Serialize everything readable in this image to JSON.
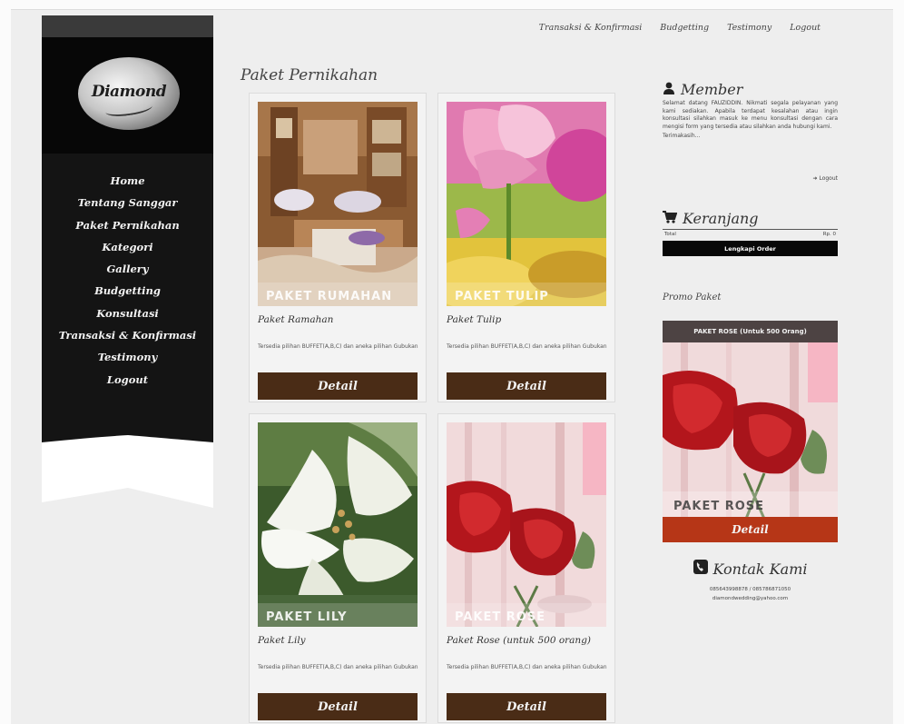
{
  "site": {
    "logo_text": "Diamond"
  },
  "sidebar": {
    "items": [
      {
        "label": "Home"
      },
      {
        "label": "Tentang Sanggar"
      },
      {
        "label": "Paket Pernikahan"
      },
      {
        "label": "Kategori"
      },
      {
        "label": "Gallery"
      },
      {
        "label": "Budgetting"
      },
      {
        "label": "Konsultasi"
      },
      {
        "label": "Transaksi & Konfirmasi"
      },
      {
        "label": "Testimony"
      },
      {
        "label": "Logout"
      }
    ]
  },
  "topnav": {
    "items": [
      {
        "label": "Transaksi & Konfirmasi"
      },
      {
        "label": "Budgetting"
      },
      {
        "label": "Testimony"
      },
      {
        "label": "Logout"
      }
    ]
  },
  "main": {
    "title": "Paket Pernikahan",
    "cards": [
      {
        "title": "Paket Ramahan",
        "image_label": "PAKET RUMAHAN",
        "description": "Tersedia pilihan BUFFET(A,B,C) dan aneka pilihan Gubukan",
        "button": "Detail"
      },
      {
        "title": "Paket Tulip",
        "image_label": "PAKET TULIP",
        "description": "Tersedia pilihan BUFFET(A,B,C) dan aneka pilihan Gubukan",
        "button": "Detail"
      },
      {
        "title": "Paket Lily",
        "image_label": "PAKET LILY",
        "description": "Tersedia pilihan BUFFET(A,B,C) dan aneka pilihan Gubukan",
        "button": "Detail"
      },
      {
        "title": "Paket Rose (untuk 500 orang)",
        "image_label": "PAKET ROSE",
        "description": "Tersedia pilihan BUFFET(A,B,C) dan aneka pilihan Gubukan",
        "button": "Detail"
      }
    ]
  },
  "member": {
    "title": "Member",
    "text": "Selamat datang FAUZIDDIN. Nikmati segala pelayanan yang kami sediakan. Apabila terdapat kesalahan atau ingin konsultasi silahkan masuk ke menu konsultasi dengan cara mengisi form yang tersedia atau silahkan anda hubungi kami.",
    "text2": "Terimakasih...",
    "logout": "Logout"
  },
  "cart": {
    "title": "Keranjang",
    "total_label": "Total",
    "total_value": "Rp. 0",
    "button": "Lengkapi Order"
  },
  "promo": {
    "title": "Promo Paket",
    "caption": "PAKET ROSE (Untuk 500 Orang)",
    "image_label": "PAKET ROSE",
    "button": "Detail"
  },
  "contact": {
    "title": "Kontak Kami",
    "phone": "085643998878 / 085786871050",
    "email": "diamondwedding@yahoo.com"
  },
  "colors": {
    "detail_button": "#4a2c16",
    "promo_button": "#b63617",
    "sidebar_bg": "#141414"
  }
}
